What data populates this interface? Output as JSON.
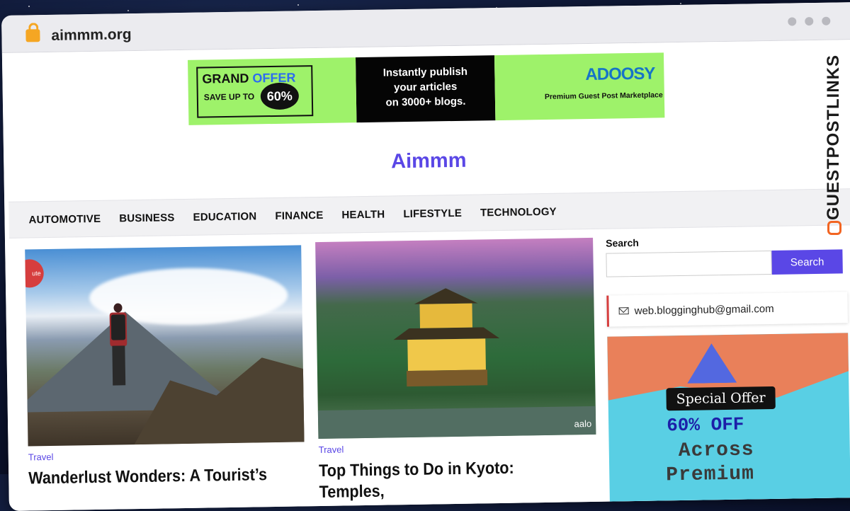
{
  "browser": {
    "url": "aimmm.org"
  },
  "banner": {
    "grand": "GRAND",
    "offer": "OFFER",
    "save_up_to": "SAVE UP TO",
    "percent": "60%",
    "headline_line1": "Instantly publish",
    "headline_line2": "your articles",
    "headline_line3": "on 3000+ blogs.",
    "brand_prefix": "A",
    "brand_rest": "DOOSY",
    "tagline": "Premium Guest Post Marketplace"
  },
  "site": {
    "brand": "Aimmm"
  },
  "nav": [
    "AUTOMOTIVE",
    "BUSINESS",
    "EDUCATION",
    "FINANCE",
    "HEALTH",
    "LIFESTYLE",
    "TECHNOLOGY"
  ],
  "posts": [
    {
      "category": "Travel",
      "title": "Wanderlust Wonders: A Tourist’s",
      "badge": "ute"
    },
    {
      "category": "Travel",
      "title": "Top Things to Do in Kyoto: Temples,",
      "watermark": "aalo"
    }
  ],
  "sidebar": {
    "search_label": "Search",
    "search_button": "Search",
    "email": "web.blogginghub@gmail.com",
    "promo": {
      "special": "Special Offer",
      "off": "60% OFF",
      "across": "Across",
      "premium": "Premium"
    }
  },
  "overlay": {
    "brand": "GUESTPOSTLINKS"
  },
  "colors": {
    "accent": "#5a47e6",
    "banner_green": "#9ef26a",
    "promo_cyan": "#59cfe4"
  }
}
